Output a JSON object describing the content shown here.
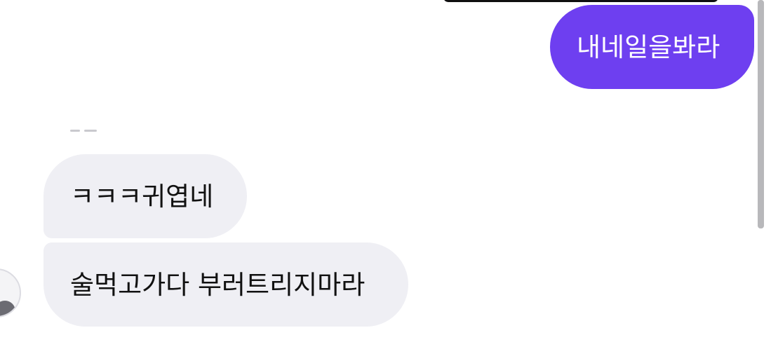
{
  "chat": {
    "messages": [
      {
        "direction": "outgoing",
        "text": "내네일을봐라"
      },
      {
        "direction": "incoming",
        "text": "ㅋㅋㅋ귀엽네"
      },
      {
        "direction": "incoming",
        "text": "술먹고가다 부러트리지마라"
      }
    ]
  },
  "colors": {
    "outgoing_bubble": "#6e3ff0",
    "incoming_bubble": "#efeff4",
    "outgoing_text": "#ffffff",
    "incoming_text": "#111111",
    "background": "#ffffff"
  }
}
